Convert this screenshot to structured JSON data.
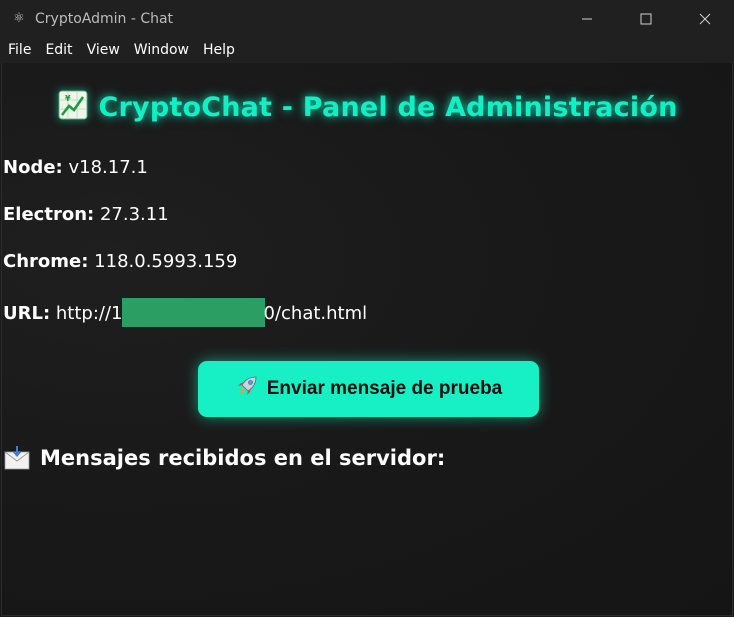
{
  "window": {
    "title": "CryptoAdmin - Chat",
    "app_icon": "electron-icon"
  },
  "menu": [
    "File",
    "Edit",
    "View",
    "Window",
    "Help"
  ],
  "page": {
    "heading": "CryptoChat - Panel de Administración",
    "heading_icon": "chart-increasing-icon",
    "accent_color": "#11f0c4"
  },
  "info": {
    "node_label": "Node:",
    "node_value": "v18.17.1",
    "electron_label": "Electron:",
    "electron_value": "27.3.11",
    "chrome_label": "Chrome:",
    "chrome_value": "118.0.5993.159",
    "url_label": "URL:",
    "url_prefix": "http://1",
    "url_suffix": "0/chat.html"
  },
  "send_button": {
    "icon": "rocket-icon",
    "label": "Enviar mensaje de prueba"
  },
  "messages_section": {
    "icon": "envelope-icon",
    "title": "Mensajes recibidos en el servidor:"
  }
}
